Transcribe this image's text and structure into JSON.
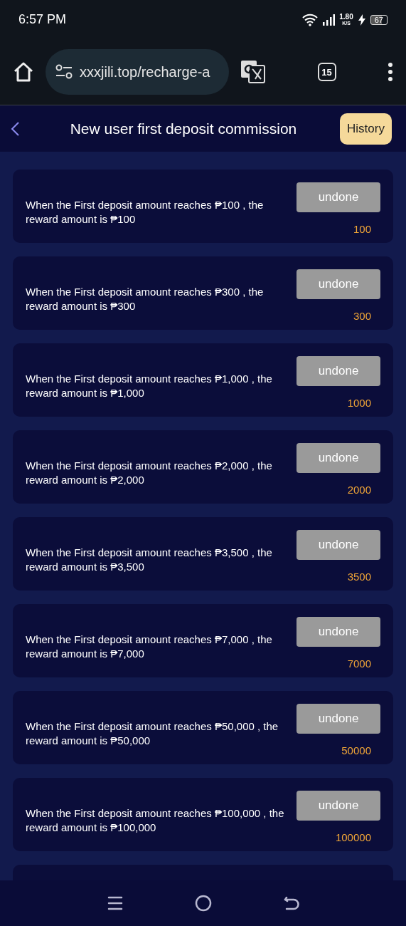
{
  "status_bar": {
    "time": "6:57 PM",
    "speed_value": "1.80",
    "speed_unit": "K/S",
    "battery": "67"
  },
  "browser": {
    "url": "xxxjili.top/recharge-a",
    "tab_count": "15"
  },
  "header": {
    "title": "New user first deposit commission",
    "history_button": "History"
  },
  "rewards": [
    {
      "text": "When the First deposit amount reaches ₱100 , the reward amount is ₱100",
      "status": "undone",
      "amount": "100"
    },
    {
      "text": "When the First deposit amount reaches ₱300 , the reward amount is ₱300",
      "status": "undone",
      "amount": "300"
    },
    {
      "text": "When the First deposit amount reaches ₱1,000 , the reward amount is ₱1,000",
      "status": "undone",
      "amount": "1000"
    },
    {
      "text": "When the First deposit amount reaches ₱2,000 , the reward amount is ₱2,000",
      "status": "undone",
      "amount": "2000"
    },
    {
      "text": "When the First deposit amount reaches ₱3,500 , the reward amount is ₱3,500",
      "status": "undone",
      "amount": "3500"
    },
    {
      "text": "When the First deposit amount reaches ₱7,000 , the reward amount is ₱7,000",
      "status": "undone",
      "amount": "7000"
    },
    {
      "text": "When the First deposit amount reaches ₱50,000 , the reward amount is ₱50,000",
      "status": "undone",
      "amount": "50000"
    },
    {
      "text": "When the First deposit amount reaches ₱100,000 , the reward amount is ₱100,000",
      "status": "undone",
      "amount": "100000"
    }
  ]
}
